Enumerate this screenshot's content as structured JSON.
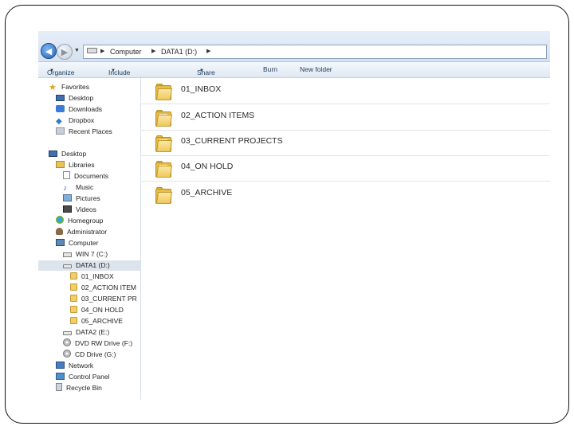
{
  "address_bar": {
    "path": [
      "Computer",
      "DATA1 (D:)"
    ]
  },
  "toolbar": {
    "organize": "Organize",
    "include_in_library": "Include in library",
    "share_with": "Share with",
    "burn": "Burn",
    "new_folder": "New folder"
  },
  "nav_pane": {
    "items": [
      {
        "label": "Favorites",
        "icon": "star-icon"
      },
      {
        "label": "Desktop",
        "icon": "desktop-icon"
      },
      {
        "label": "Downloads",
        "icon": "downloads-icon"
      },
      {
        "label": "Dropbox",
        "icon": "dropbox-icon"
      },
      {
        "label": "Recent Places",
        "icon": "recent-places-icon"
      },
      {
        "label": "Desktop",
        "icon": "desktop-icon"
      },
      {
        "label": "Libraries",
        "icon": "libraries-icon"
      },
      {
        "label": "Documents",
        "icon": "documents-icon"
      },
      {
        "label": "Music",
        "icon": "music-icon"
      },
      {
        "label": "Pictures",
        "icon": "pictures-icon"
      },
      {
        "label": "Videos",
        "icon": "videos-icon"
      },
      {
        "label": "Homegroup",
        "icon": "homegroup-icon"
      },
      {
        "label": "Administrator",
        "icon": "user-icon"
      },
      {
        "label": "Computer",
        "icon": "computer-icon"
      },
      {
        "label": "WIN 7 (C:)",
        "icon": "windows-drive-icon"
      },
      {
        "label": "DATA1 (D:)",
        "icon": "drive-icon",
        "selected": true
      },
      {
        "label": "01_INBOX",
        "icon": "folder-icon"
      },
      {
        "label": "02_ACTION ITEM",
        "icon": "folder-icon"
      },
      {
        "label": "03_CURRENT PR",
        "icon": "folder-icon"
      },
      {
        "label": "04_ON HOLD",
        "icon": "folder-icon"
      },
      {
        "label": "05_ARCHIVE",
        "icon": "folder-icon"
      },
      {
        "label": "DATA2 (E:)",
        "icon": "drive-icon"
      },
      {
        "label": "DVD RW Drive (F:)",
        "icon": "dvd-drive-icon"
      },
      {
        "label": "CD Drive (G:)",
        "icon": "cd-drive-icon"
      },
      {
        "label": "Network",
        "icon": "network-icon"
      },
      {
        "label": "Control Panel",
        "icon": "control-panel-icon"
      },
      {
        "label": "Recycle Bin",
        "icon": "recycle-bin-icon"
      }
    ]
  },
  "content": {
    "folders": [
      {
        "name": "01_INBOX"
      },
      {
        "name": "02_ACTION ITEMS"
      },
      {
        "name": "03_CURRENT PROJECTS"
      },
      {
        "name": "04_ON HOLD"
      },
      {
        "name": "05_ARCHIVE"
      }
    ]
  }
}
